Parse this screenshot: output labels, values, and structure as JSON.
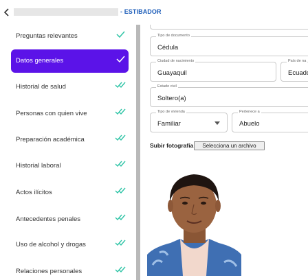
{
  "header": {
    "back_icon": "chevron-left-icon",
    "title": "- ESTIBADOR"
  },
  "sidebar": {
    "items": [
      {
        "label": "Preguntas relevantes",
        "check": "single",
        "active": false
      },
      {
        "label": "Datos generales",
        "check": "single",
        "active": true
      },
      {
        "label": "Historial de salud",
        "check": "double",
        "active": false
      },
      {
        "label": "Personas con quien vive",
        "check": "double",
        "active": false
      },
      {
        "label": "Preparación académica",
        "check": "double",
        "active": false
      },
      {
        "label": "Historial laboral",
        "check": "double",
        "active": false
      },
      {
        "label": "Actos ilícitos",
        "check": "double",
        "active": false
      },
      {
        "label": "Antecedentes penales",
        "check": "double",
        "active": false
      },
      {
        "label": "Uso de alcohol y drogas",
        "check": "double",
        "active": false
      },
      {
        "label": "Relaciones personales",
        "check": "double",
        "active": false
      }
    ]
  },
  "form": {
    "tipo_documento": {
      "label": "Tipo de documento",
      "value": "Cédula"
    },
    "ciudad_nacimiento": {
      "label": "Ciudad de nacimiento",
      "value": "Guayaquil"
    },
    "pais": {
      "label": "País de na",
      "value": "Ecuado"
    },
    "estado_civil": {
      "label": "Estado civil",
      "value": "Soltero(a)"
    },
    "tipo_vivienda": {
      "label": "Tipo de vivienda",
      "value": "Familiar"
    },
    "pertenece": {
      "label": "Pertenece a",
      "value": "Abuelo"
    },
    "photo": {
      "label": "Subir fotografía",
      "button": "Selecciona un archivo"
    }
  },
  "colors": {
    "accent": "#5b13e8",
    "check": "#2ec4a6",
    "title": "#1a5bb8",
    "divider": "#b9b9b9"
  }
}
